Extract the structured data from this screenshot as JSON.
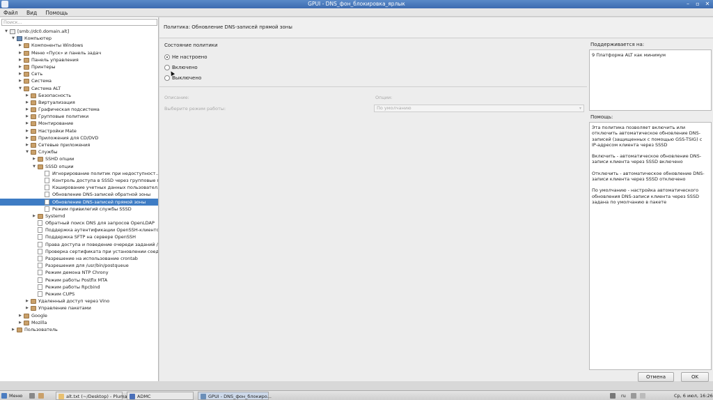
{
  "window": {
    "title": "GPUI - DNS_фон_блокировка_ярлык"
  },
  "menu": [
    "Файл",
    "Вид",
    "Помощь"
  ],
  "search": {
    "placeholder": "Поиск..."
  },
  "tree": [
    {
      "label": "[smb://dc0.domain.alt]",
      "level": 0,
      "arrow": "down",
      "icon": "network"
    },
    {
      "label": "Компьютер",
      "level": 1,
      "arrow": "down",
      "icon": "computer"
    },
    {
      "label": "Компоненты Windows",
      "level": 2,
      "arrow": "right",
      "icon": "folder"
    },
    {
      "label": "Меню «Пуск» и панель задач",
      "level": 2,
      "arrow": "right",
      "icon": "folder"
    },
    {
      "label": "Панель управления",
      "level": 2,
      "arrow": "right",
      "icon": "folder"
    },
    {
      "label": "Принтеры",
      "level": 2,
      "arrow": "right",
      "icon": "folder"
    },
    {
      "label": "Сеть",
      "level": 2,
      "arrow": "right",
      "icon": "folder"
    },
    {
      "label": "Система",
      "level": 2,
      "arrow": "right",
      "icon": "folder"
    },
    {
      "label": "Система ALT",
      "level": 2,
      "arrow": "down",
      "icon": "folder"
    },
    {
      "label": "Безопасность",
      "level": 3,
      "arrow": "right",
      "icon": "folder"
    },
    {
      "label": "Виртуализация",
      "level": 3,
      "arrow": "right",
      "icon": "folder"
    },
    {
      "label": "Графическая подсистема",
      "level": 3,
      "arrow": "right",
      "icon": "folder"
    },
    {
      "label": "Групповые политики",
      "level": 3,
      "arrow": "right",
      "icon": "folder"
    },
    {
      "label": "Монтирование",
      "level": 3,
      "arrow": "right",
      "icon": "folder"
    },
    {
      "label": "Настройки Mate",
      "level": 3,
      "arrow": "right",
      "icon": "folder"
    },
    {
      "label": "Приложения для CD/DVD",
      "level": 3,
      "arrow": "right",
      "icon": "folder"
    },
    {
      "label": "Сетевые приложения",
      "level": 3,
      "arrow": "right",
      "icon": "folder"
    },
    {
      "label": "Службы",
      "level": 3,
      "arrow": "down",
      "icon": "folder"
    },
    {
      "label": "SSHD опции",
      "level": 4,
      "arrow": "right",
      "icon": "folder"
    },
    {
      "label": "SSSD опции",
      "level": 4,
      "arrow": "down",
      "icon": "folder"
    },
    {
      "label": "Игнорирование политик при недоступност...",
      "level": 5,
      "arrow": "",
      "icon": "doc"
    },
    {
      "label": "Контроль доступа в SSSD через групповые п...",
      "level": 5,
      "arrow": "",
      "icon": "doc"
    },
    {
      "label": "Кэширование учетных данных пользовател...",
      "level": 5,
      "arrow": "",
      "icon": "doc"
    },
    {
      "label": "Обновление DNS-записей обратной зоны",
      "level": 5,
      "arrow": "",
      "icon": "doc"
    },
    {
      "label": "Обновление DNS-записей прямой зоны",
      "level": 5,
      "arrow": "",
      "icon": "doc",
      "selected": true
    },
    {
      "label": "Режим привилегий службы SSSD",
      "level": 5,
      "arrow": "",
      "icon": "doc"
    },
    {
      "label": "Systemd",
      "level": 4,
      "arrow": "right",
      "icon": "folder"
    },
    {
      "label": "Обратный поиск DNS для запросов OpenLDAP",
      "level": 4,
      "arrow": "",
      "icon": "doc"
    },
    {
      "label": "Поддержка аутентификации OpenSSH-клиенто...",
      "level": 4,
      "arrow": "",
      "icon": "doc"
    },
    {
      "label": "Поддержка SFTP на сервере OpenSSH",
      "level": 4,
      "arrow": "",
      "icon": "doc"
    },
    {
      "label": "Права доступа и поведение очереди заданий /...",
      "level": 4,
      "arrow": "",
      "icon": "doc"
    },
    {
      "label": "Проверка сертификата при установлении соед...",
      "level": 4,
      "arrow": "",
      "icon": "doc"
    },
    {
      "label": "Разрешение на использование crontab",
      "level": 4,
      "arrow": "",
      "icon": "doc"
    },
    {
      "label": "Разрешения для /usr/bin/postqueue",
      "level": 4,
      "arrow": "",
      "icon": "doc"
    },
    {
      "label": "Режим демона NTP Chrony",
      "level": 4,
      "arrow": "",
      "icon": "doc"
    },
    {
      "label": "Режим работы Postfix MTA",
      "level": 4,
      "arrow": "",
      "icon": "doc"
    },
    {
      "label": "Режим работы Rpcbind",
      "level": 4,
      "arrow": "",
      "icon": "doc"
    },
    {
      "label": "Режим CUPS",
      "level": 4,
      "arrow": "",
      "icon": "doc"
    },
    {
      "label": "Удаленный доступ через Vino",
      "level": 3,
      "arrow": "right",
      "icon": "folder"
    },
    {
      "label": "Управление пакетами",
      "level": 3,
      "arrow": "right",
      "icon": "folder"
    },
    {
      "label": "Google",
      "level": 2,
      "arrow": "right",
      "icon": "folder"
    },
    {
      "label": "Mozilla",
      "level": 2,
      "arrow": "right",
      "icon": "folder"
    },
    {
      "label": "Пользователь",
      "level": 1,
      "arrow": "right",
      "icon": "folder"
    }
  ],
  "policy": {
    "header": "Политика: Обновление DNS-записей прямой зоны",
    "state_label": "Состояние политики",
    "options": [
      "Не настроено",
      "Включено",
      "Выключено"
    ],
    "selected_option": 0,
    "description_label": "Описание:",
    "mode_label": "Выберите режим работы:",
    "options_label": "Опции:",
    "dropdown_value": "По умолчанию"
  },
  "supported": {
    "label": "Поддерживается на:",
    "value": "9 Платформа ALT как минимум"
  },
  "help": {
    "label": "Помощь:",
    "paragraphs": [
      "Эта политика позволяет включить или отключить автоматическое обновление DNS-записей (защищенных с помощью GSS-TSIG) с IP-адресом клиента через SSSD",
      "Включить - автоматическое обновление DNS-записи клиента через SSSD включено",
      "Отключить - автоматическое обновление DNS-записи клиента через SSSD отключено",
      "По умолчанию - настройка автоматического обновления DNS-записи клиента через SSSD задана по умолчанию в пакете"
    ]
  },
  "buttons": {
    "cancel": "Отмена",
    "ok": "OK"
  },
  "taskbar": {
    "menu": "Меню",
    "tasks": [
      "alt.txt (~/Desktop) - Pluma",
      "ADMC",
      "GPUI - DNS_фон_блокиро..."
    ],
    "lang": "ru",
    "clock": "Ср, 6 июл, 16:26"
  }
}
